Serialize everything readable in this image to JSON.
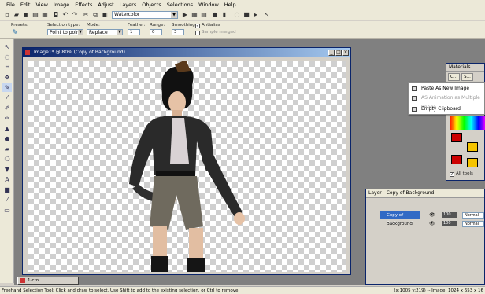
{
  "menubar": [
    "File",
    "Edit",
    "View",
    "Image",
    "Effects",
    "Adjust",
    "Layers",
    "Objects",
    "Selections",
    "Window",
    "Help"
  ],
  "toolbar": {
    "style_dropdown": "Watercolor"
  },
  "options": {
    "presets_label": "Presets:",
    "selection_type_label": "Selection type:",
    "selection_type_value": "Point to point",
    "mode_label": "Mode:",
    "mode_value": "Replace",
    "feather_label": "Feather:",
    "feather_value": "1",
    "range_label": "Range:",
    "range_value": "0",
    "smoothing_label": "Smoothing:",
    "smoothing_value": "3",
    "antialias_label": "Antialias",
    "sample_merged_label": "Sample merged"
  },
  "image_window": {
    "title": "Image1* @ 80% (Copy of Background)"
  },
  "materials": {
    "title": "Materials",
    "tab1": "C...",
    "tab2": "S...",
    "all_tools_label": "All tools"
  },
  "context_menu": {
    "items": [
      {
        "label": "Paste As New Image",
        "enabled": true
      },
      {
        "label": "AS Animation as Multiple Image",
        "enabled": false
      },
      {
        "label": "Empty Clipboard",
        "enabled": true
      }
    ]
  },
  "layers_panel": {
    "title": "Layer - Copy of Background",
    "layers": [
      {
        "name": "Copy of Background",
        "opacity": "100",
        "blend": "Normal",
        "selected": true
      },
      {
        "name": "Background",
        "opacity": "100",
        "blend": "Normal",
        "selected": false
      }
    ]
  },
  "taskbar": {
    "item": "1-cro..."
  },
  "status": {
    "message": "Freehand Selection Tool: Click and draw to select. Use Shift to add to the existing selection, or Ctrl to remove.",
    "info": "(x:1005 y:219) -- Image: 1024 x 653 x 16"
  },
  "colors": {
    "title_active": "#0a246a",
    "selection": "#316ac5",
    "fg_swatch": "#cc0000",
    "bg_swatch": "#f5c400"
  }
}
